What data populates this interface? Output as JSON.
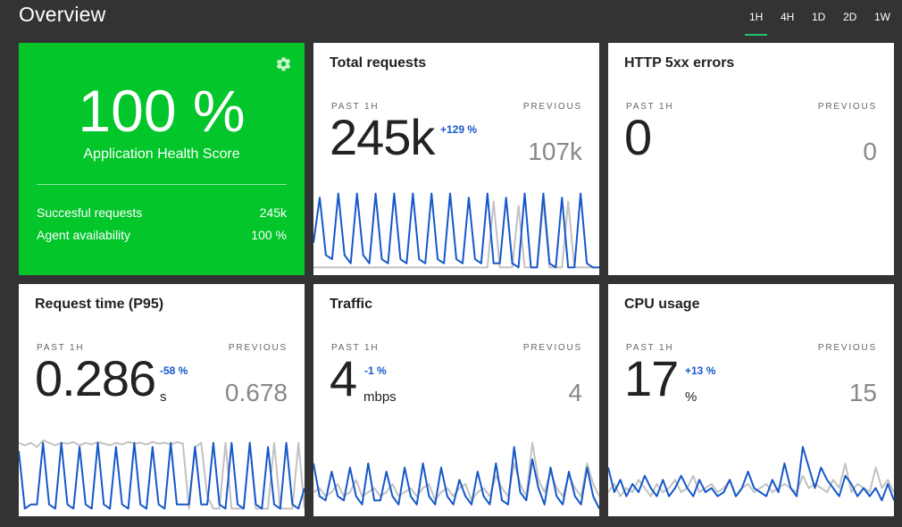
{
  "header": {
    "title": "Overview",
    "ranges": [
      "1H",
      "4H",
      "1D",
      "2D",
      "1W"
    ],
    "selected_range": "1H"
  },
  "colors": {
    "background": "#333333",
    "health_green": "#02c62a",
    "current_line": "#1558c9",
    "previous_line": "#c2c2c2",
    "accent_tab": "#1dc26b"
  },
  "health": {
    "score": "100 %",
    "score_label": "Application Health Score",
    "rows": [
      {
        "label": "Succesful requests",
        "value": "245k"
      },
      {
        "label": "Agent availability",
        "value": "100 %"
      }
    ],
    "settings_icon": "gear-icon"
  },
  "cards": [
    {
      "id": "total-requests",
      "title": "Total requests",
      "current_label": "PAST 1H",
      "previous_label": "PREVIOUS",
      "value": "245k",
      "unit": "",
      "delta": "+129 %",
      "previous": "107k",
      "current_series": [
        0.35,
        0.9,
        0.2,
        0.15,
        0.95,
        0.2,
        0.1,
        0.95,
        0.2,
        0.1,
        0.95,
        0.15,
        0.1,
        0.95,
        0.15,
        0.1,
        0.95,
        0.15,
        0.1,
        0.95,
        0.15,
        0.1,
        0.95,
        0.15,
        0.1,
        0.9,
        0.15,
        0.1,
        0.95,
        0.1,
        0.1,
        0.9,
        0.1,
        0.05,
        0.95,
        0.05,
        0.05,
        0.95,
        0.1,
        0.05,
        0.9,
        0.05,
        0.05,
        0.95,
        0.1,
        0.05,
        0.05
      ],
      "previous_series": [
        0.05,
        0.05,
        0.05,
        0.05,
        0.05,
        0.05,
        0.05,
        0.05,
        0.05,
        0.05,
        0.05,
        0.05,
        0.05,
        0.05,
        0.05,
        0.05,
        0.05,
        0.05,
        0.05,
        0.05,
        0.05,
        0.05,
        0.05,
        0.05,
        0.05,
        0.05,
        0.05,
        0.05,
        0.05,
        0.85,
        0.05,
        0.05,
        0.05,
        0.8,
        0.05,
        0.05,
        0.05,
        0.85,
        0.05,
        0.05,
        0.05,
        0.85,
        0.05,
        0.05,
        0.05,
        0.05,
        0.05
      ]
    },
    {
      "id": "http-5xx",
      "title": "HTTP 5xx errors",
      "current_label": "PAST 1H",
      "previous_label": "PREVIOUS",
      "value": "0",
      "unit": "",
      "delta": "",
      "previous": "0",
      "current_series": [],
      "previous_series": []
    },
    {
      "id": "request-time",
      "title": "Request time (P95)",
      "current_label": "PAST 1H",
      "previous_label": "PREVIOUS",
      "value": "0.286",
      "unit": "s",
      "delta": "-58 %",
      "previous": "0.678",
      "current_series": [
        0.75,
        0.05,
        0.1,
        0.1,
        0.85,
        0.1,
        0.05,
        0.85,
        0.1,
        0.05,
        0.8,
        0.1,
        0.05,
        0.85,
        0.1,
        0.05,
        0.8,
        0.1,
        0.05,
        0.85,
        0.1,
        0.05,
        0.8,
        0.1,
        0.05,
        0.85,
        0.1,
        0.1,
        0.1,
        0.8,
        0.1,
        0.1,
        0.85,
        0.1,
        0.05,
        0.85,
        0.1,
        0.05,
        0.85,
        0.1,
        0.05,
        0.8,
        0.1,
        0.05,
        0.85,
        0.1,
        0.05,
        0.3
      ],
      "previous_series": [
        0.85,
        0.82,
        0.85,
        0.8,
        0.88,
        0.85,
        0.82,
        0.85,
        0.84,
        0.86,
        0.82,
        0.85,
        0.83,
        0.86,
        0.84,
        0.82,
        0.85,
        0.83,
        0.86,
        0.84,
        0.85,
        0.83,
        0.86,
        0.84,
        0.85,
        0.83,
        0.86,
        0.84,
        0.05,
        0.8,
        0.85,
        0.2,
        0.05,
        0.05,
        0.85,
        0.05,
        0.05,
        0.05,
        0.85,
        0.05,
        0.05,
        0.05,
        0.85,
        0.05,
        0.05,
        0.05,
        0.85,
        0.05
      ]
    },
    {
      "id": "traffic",
      "title": "Traffic",
      "current_label": "PAST 1H",
      "previous_label": "PREVIOUS",
      "value": "4",
      "unit": "mbps",
      "delta": "-1 %",
      "previous": "4",
      "current_series": [
        0.6,
        0.2,
        0.15,
        0.5,
        0.2,
        0.15,
        0.55,
        0.2,
        0.1,
        0.6,
        0.15,
        0.15,
        0.5,
        0.2,
        0.1,
        0.55,
        0.2,
        0.1,
        0.6,
        0.2,
        0.1,
        0.55,
        0.2,
        0.1,
        0.4,
        0.2,
        0.1,
        0.5,
        0.2,
        0.1,
        0.6,
        0.15,
        0.1,
        0.8,
        0.25,
        0.15,
        0.65,
        0.3,
        0.1,
        0.55,
        0.2,
        0.1,
        0.5,
        0.2,
        0.1,
        0.55,
        0.2,
        0.05
      ],
      "previous_series": [
        0.25,
        0.3,
        0.2,
        0.25,
        0.35,
        0.2,
        0.25,
        0.4,
        0.2,
        0.25,
        0.3,
        0.2,
        0.25,
        0.35,
        0.2,
        0.25,
        0.3,
        0.2,
        0.3,
        0.35,
        0.15,
        0.25,
        0.3,
        0.2,
        0.3,
        0.35,
        0.15,
        0.25,
        0.3,
        0.2,
        0.45,
        0.3,
        0.2,
        0.6,
        0.35,
        0.2,
        0.85,
        0.4,
        0.25,
        0.5,
        0.3,
        0.2,
        0.45,
        0.3,
        0.2,
        0.6,
        0.35,
        0.2
      ]
    },
    {
      "id": "cpu-usage",
      "title": "CPU usage",
      "current_label": "PAST 1H",
      "previous_label": "PREVIOUS",
      "value": "17",
      "unit": "%",
      "delta": "+13 %",
      "previous": "15",
      "current_series": [
        0.55,
        0.25,
        0.4,
        0.2,
        0.35,
        0.25,
        0.45,
        0.3,
        0.2,
        0.4,
        0.2,
        0.3,
        0.45,
        0.3,
        0.2,
        0.4,
        0.25,
        0.3,
        0.2,
        0.25,
        0.4,
        0.2,
        0.3,
        0.5,
        0.3,
        0.25,
        0.2,
        0.4,
        0.25,
        0.6,
        0.3,
        0.2,
        0.8,
        0.55,
        0.3,
        0.55,
        0.4,
        0.3,
        0.2,
        0.45,
        0.35,
        0.2,
        0.3,
        0.2,
        0.3,
        0.15,
        0.35,
        0.15
      ],
      "previous_series": [
        0.25,
        0.35,
        0.2,
        0.3,
        0.25,
        0.4,
        0.3,
        0.2,
        0.35,
        0.25,
        0.3,
        0.4,
        0.25,
        0.3,
        0.45,
        0.25,
        0.3,
        0.35,
        0.25,
        0.3,
        0.4,
        0.2,
        0.3,
        0.35,
        0.25,
        0.3,
        0.35,
        0.25,
        0.3,
        0.35,
        0.3,
        0.25,
        0.45,
        0.3,
        0.35,
        0.3,
        0.25,
        0.4,
        0.3,
        0.6,
        0.25,
        0.35,
        0.3,
        0.25,
        0.55,
        0.3,
        0.4,
        0.25
      ]
    }
  ]
}
